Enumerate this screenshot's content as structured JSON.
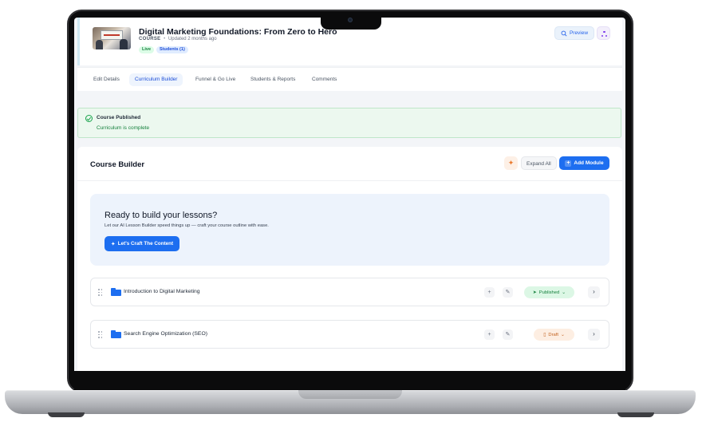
{
  "course": {
    "title": "Digital Marketing Foundations: From Zero to Hero",
    "kind": "COURSE",
    "separator": "•",
    "updated": "Updated 2 months ago",
    "status_badge": "Live",
    "students_badge": "Students (1)"
  },
  "header_actions": {
    "preview_label": "Preview"
  },
  "tabs": [
    {
      "label": "Edit Details"
    },
    {
      "label": "Curriculum Builder",
      "active": true
    },
    {
      "label": "Funnel & Go Live"
    },
    {
      "label": "Students & Reports"
    },
    {
      "label": "Comments"
    }
  ],
  "alert": {
    "title": "Course Published",
    "message": "Curriculum is complete"
  },
  "builder": {
    "title": "Course Builder",
    "expand_label": "Expand All",
    "add_label": "Add Module"
  },
  "ai_card": {
    "title": "Ready to build your lessons?",
    "subtitle": "Let our AI Lesson Builder speed things up — craft your course outline with ease.",
    "button_label": "Let's Craft The Content"
  },
  "modules": [
    {
      "title": "Introduction to Digital Marketing",
      "status": "Published"
    },
    {
      "title": "Search Engine Optimization (SEO)",
      "status": "Draft"
    }
  ],
  "colors": {
    "accent": "#1d6ef0",
    "success": "#15803d",
    "warning": "#c2611f"
  },
  "icons": [
    "folder-icon",
    "drag-handle-icon",
    "sparkle-icon",
    "plus-icon",
    "pencil-icon",
    "chevron-right-icon",
    "chevron-down-icon",
    "check-circle-icon",
    "share-icon",
    "eye-icon",
    "send-icon",
    "document-icon"
  ]
}
